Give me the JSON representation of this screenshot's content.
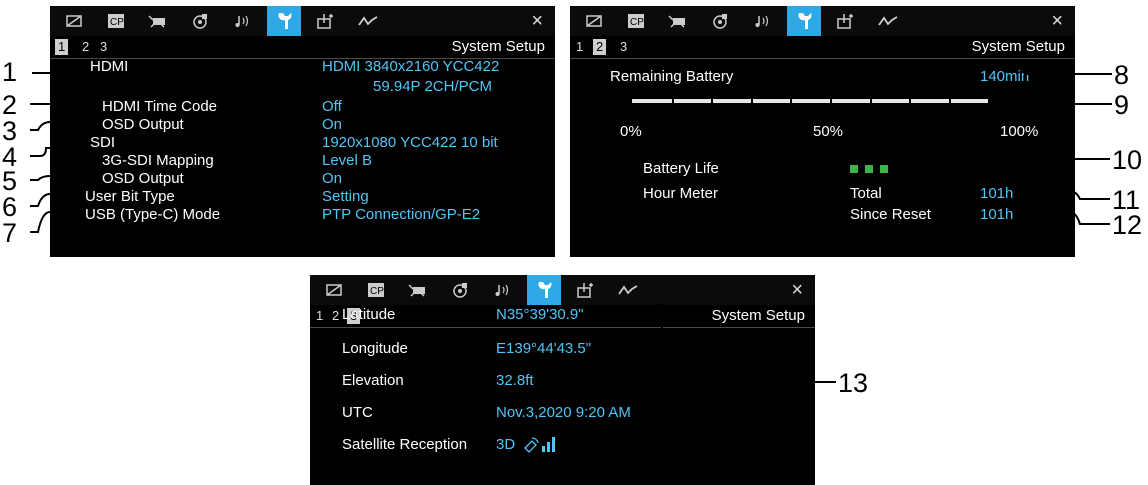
{
  "tabs": [
    "image-icon",
    "cp-icon",
    "camera-icon",
    "media-icon",
    "audio-icon",
    "wrench-icon",
    "assign-icon",
    "network-icon"
  ],
  "close_glyph": "×",
  "pages": [
    "1",
    "2",
    "3"
  ],
  "screen1": {
    "title": "System Setup",
    "rows": [
      {
        "label": "HDMI",
        "value": "HDMI   3840x2160 YCC422"
      },
      {
        "label": "",
        "value": "59.94P   2CH/PCM"
      },
      {
        "label": "HDMI Time Code",
        "value": "Off"
      },
      {
        "label": "OSD Output",
        "value": "On"
      },
      {
        "label": "SDI",
        "value": "1920x1080 YCC422 10 bit"
      },
      {
        "label": "3G-SDI Mapping",
        "value": "Level B"
      },
      {
        "label": "OSD Output",
        "value": "On"
      },
      {
        "label": "User Bit Type",
        "value": "Setting"
      },
      {
        "label": "USB (Type-C) Mode",
        "value": "PTP Connection/GP-E2"
      }
    ]
  },
  "screen2": {
    "title": "System Setup",
    "remaining_label": "Remaining Battery",
    "remaining_value": "140min",
    "battery_level": 0.9,
    "scale": [
      "0%",
      "50%",
      "100%"
    ],
    "battery_life_label": "Battery Life",
    "hour_meter_label": "Hour Meter",
    "total_label": "Total",
    "total_value": "101h",
    "since_reset_label": "Since Reset",
    "since_reset_value": "101h"
  },
  "screen3": {
    "title": "System Setup",
    "rows": [
      {
        "label": "Latitude",
        "value": "N35°39'30.9\""
      },
      {
        "label": "Longitude",
        "value": "E139°44'43.5\""
      },
      {
        "label": "Elevation",
        "value": "32.8ft"
      },
      {
        "label": "UTC",
        "value": "Nov.3,2020 9:20 AM"
      },
      {
        "label": "Satellite Reception",
        "value": "3D"
      }
    ]
  },
  "callouts": [
    "1",
    "2",
    "3",
    "4",
    "5",
    "6",
    "7",
    "8",
    "9",
    "10",
    "11",
    "12",
    "13"
  ],
  "colors": {
    "accent": "#2fa8e6",
    "value": "#52c4f5",
    "battery_green": "#3bb54a"
  }
}
